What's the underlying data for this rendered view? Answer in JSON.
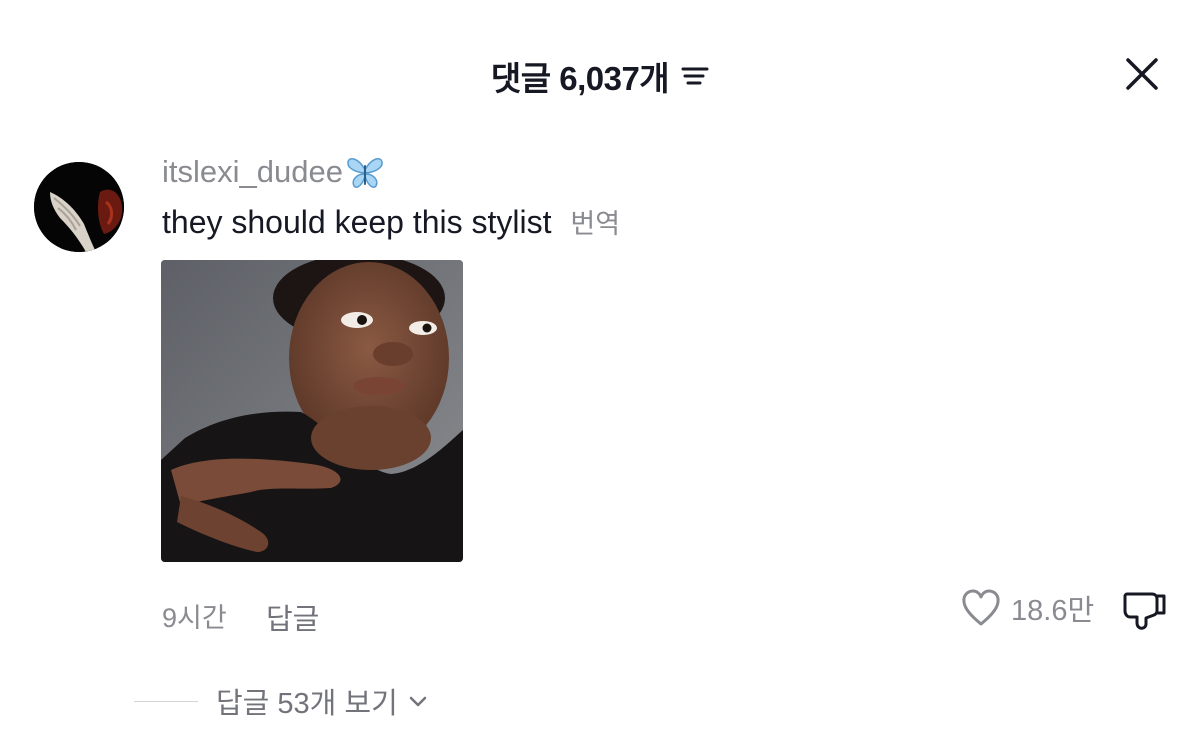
{
  "header": {
    "title": "댓글 6,037개",
    "sort_icon": "sort-lines-icon",
    "close_icon": "close-x-icon"
  },
  "comment": {
    "username": "itslexi_dudee",
    "username_emoji": "butterfly-icon",
    "text": "they should keep this stylist",
    "translate_label": "번역",
    "time": "9시간",
    "reply_label": "답글",
    "likes": "18.6만",
    "view_replies_label": "답글 53개 보기"
  },
  "colors": {
    "primary_text": "#161823",
    "secondary_text": "#8a8b91",
    "butterfly": "#8ec8f0"
  }
}
